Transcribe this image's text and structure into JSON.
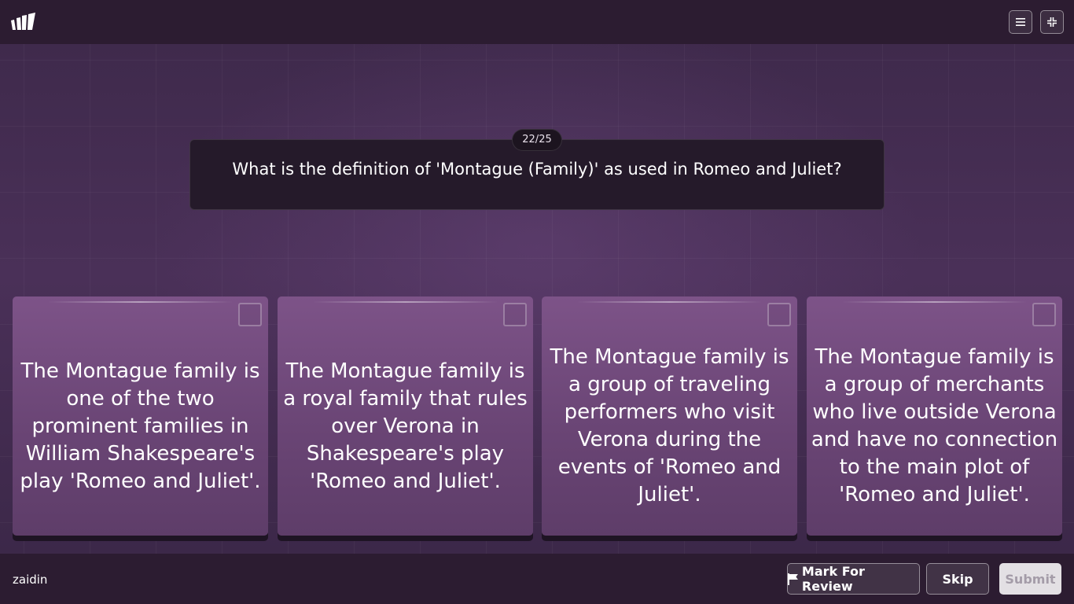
{
  "header": {
    "logo": "brand-logo-icon",
    "menu_icon": "menu-icon",
    "collapse_icon": "collapse-icon"
  },
  "question": {
    "counter": "22/25",
    "text": "What is the definition of 'Montague (Family)' as used in Romeo and Juliet?"
  },
  "options": [
    {
      "text": "The Montague family is one of the two prominent families in William Shakespeare's play 'Romeo and Juliet'.",
      "checked": false
    },
    {
      "text": "The Montague family is a royal family that rules over Verona in Shakespeare's play 'Romeo and Juliet'.",
      "checked": false
    },
    {
      "text": "The Montague family is a group of traveling performers who visit Verona during the events of 'Romeo and Juliet'.",
      "checked": false
    },
    {
      "text": "The Montague family is a group of merchants who live outside Verona and have no connection to the main plot of 'Romeo and Juliet'.",
      "checked": false
    }
  ],
  "footer": {
    "username": "zaidin",
    "mark_label": "Mark For Review",
    "mark_icon": "flag-icon",
    "skip_label": "Skip",
    "submit_label": "Submit",
    "submit_disabled": true
  }
}
